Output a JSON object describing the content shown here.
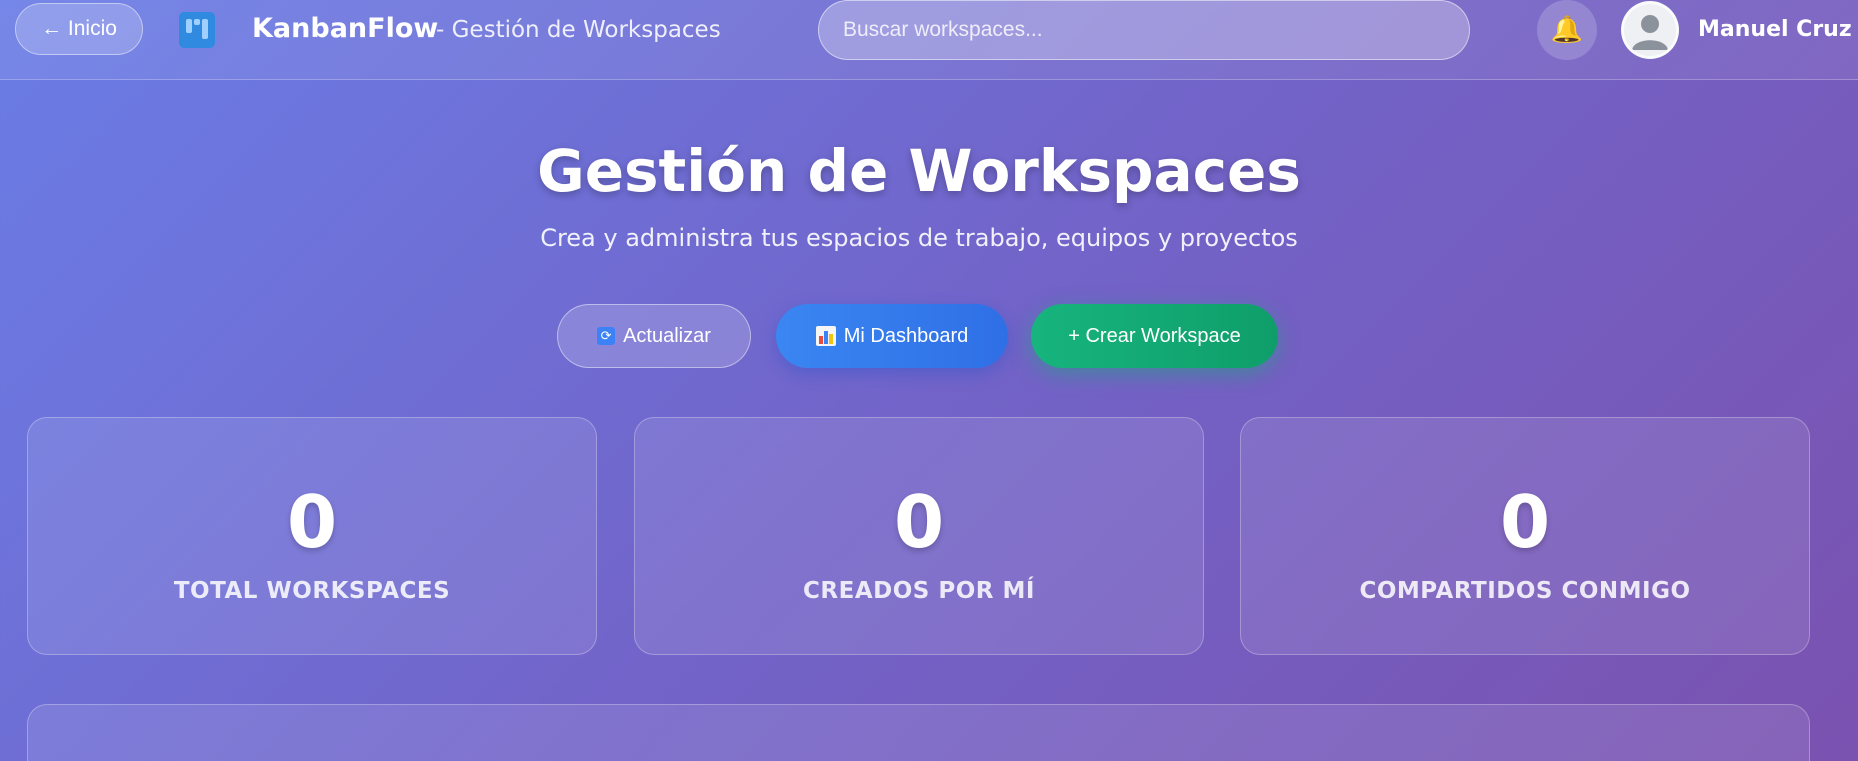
{
  "header": {
    "back_label": "← Inicio",
    "brand": "KanbanFlow",
    "section": "- Gestión de Workspaces",
    "search_placeholder": "Buscar workspaces...",
    "user_name": "Manuel Cruz"
  },
  "hero": {
    "title": "Gestión de Workspaces",
    "subtitle": "Crea y administra tus espacios de trabajo, equipos y proyectos"
  },
  "actions": {
    "refresh": "Actualizar",
    "dashboard": "Mi Dashboard",
    "create": "+ Crear Workspace"
  },
  "stats": [
    {
      "value": "0",
      "label": "TOTAL WORKSPACES"
    },
    {
      "value": "0",
      "label": "CREADOS POR MÍ"
    },
    {
      "value": "0",
      "label": "COMPARTIDOS CONMIGO"
    }
  ],
  "colors": {
    "accent_blue": "#2f6fe6",
    "accent_green": "#0f9e6a",
    "bell": "#f3b43c"
  }
}
